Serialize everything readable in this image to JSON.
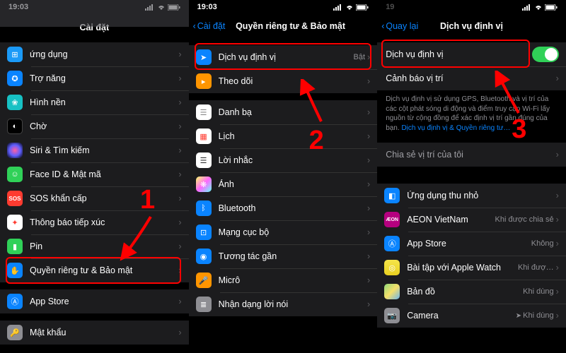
{
  "status": {
    "time": "19:03"
  },
  "annotations": {
    "n1": "1",
    "n2": "2",
    "n3": "3"
  },
  "phone1": {
    "title": "Cài đặt",
    "rows": [
      {
        "label": "ứng dụng"
      },
      {
        "label": "Trợ năng"
      },
      {
        "label": "Hình nền"
      },
      {
        "label": "Chờ"
      },
      {
        "label": "Siri & Tìm kiếm"
      },
      {
        "label": "Face ID & Mật mã"
      },
      {
        "label": "SOS khẩn cấp"
      },
      {
        "label": "Thông báo tiếp xúc"
      },
      {
        "label": "Pin"
      },
      {
        "label": "Quyền riêng tư & Bảo mật"
      }
    ],
    "rows2": [
      {
        "label": "App Store"
      }
    ],
    "rows3": [
      {
        "label": "Mật khẩu"
      }
    ]
  },
  "phone2": {
    "back": "Cài đặt",
    "title": "Quyền riêng tư & Bảo mật",
    "group1": [
      {
        "label": "Dịch vụ định vị",
        "value": "Bật"
      },
      {
        "label": "Theo dõi"
      }
    ],
    "group2": [
      {
        "label": "Danh bạ"
      },
      {
        "label": "Lịch"
      },
      {
        "label": "Lời nhắc"
      },
      {
        "label": "Ảnh"
      },
      {
        "label": "Bluetooth"
      },
      {
        "label": "Mạng cục bộ"
      },
      {
        "label": "Tương tác gần"
      },
      {
        "label": "Micrô"
      },
      {
        "label": "Nhận dạng lời nói"
      }
    ]
  },
  "phone3": {
    "back": "Quay lại",
    "title": "Dịch vụ định vị",
    "group1": [
      {
        "label": "Dịch vụ định vị"
      },
      {
        "label": "Cảnh báo vị trí"
      }
    ],
    "footer": "Dịch vụ định vị sử dụng GPS, Bluetooth và vị trí của các cột phát sóng di động và điểm truy cập Wi-Fi lấy nguồn từ cộng đồng để xác định vị trí gần đúng của bạn.",
    "footer_link": "Dịch vụ định vị & Quyền riêng tư…",
    "group2": [
      {
        "label": "Chia sẻ vị trí của tôi"
      }
    ],
    "group3": [
      {
        "label": "Ứng dụng thu nhỏ",
        "value": ""
      },
      {
        "label": "AEON VietNam",
        "value": "Khi được chia sẻ"
      },
      {
        "label": "App Store",
        "value": "Không"
      },
      {
        "label": "Bài tập với Apple Watch",
        "value": "Khi đượ…"
      },
      {
        "label": "Bản đồ",
        "value": "Khi dùng"
      },
      {
        "label": "Camera",
        "value": "Khi dùng"
      }
    ]
  }
}
